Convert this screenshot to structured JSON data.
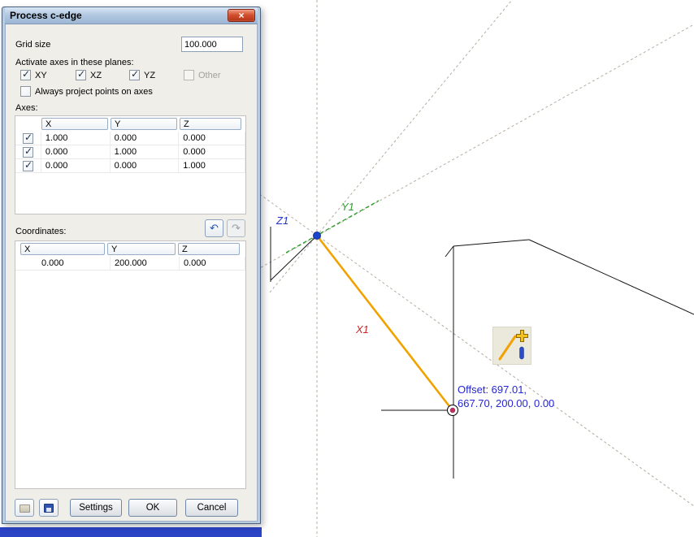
{
  "window": {
    "title": "Process c-edge",
    "icons": {
      "close": "×",
      "undo": "↶",
      "redo": "↷"
    }
  },
  "form": {
    "grid_size_label": "Grid size",
    "grid_size_value": "100.000",
    "planes_label": "Activate axes in these planes:",
    "planes": [
      {
        "label": "XY",
        "check": "✓"
      },
      {
        "label": "XZ",
        "check": "✓"
      },
      {
        "label": "YZ",
        "check": "✓"
      },
      {
        "label": "Other",
        "check": ""
      }
    ],
    "project_points": {
      "label": "Always project points on axes",
      "check": ""
    },
    "axes_label": "Axes:",
    "axes_table": {
      "headers": [
        "X",
        "Y",
        "Z"
      ],
      "rows": [
        {
          "check": "✓",
          "values": [
            "1.000",
            "0.000",
            "0.000"
          ]
        },
        {
          "check": "✓",
          "values": [
            "0.000",
            "1.000",
            "0.000"
          ]
        },
        {
          "check": "✓",
          "values": [
            "0.000",
            "0.000",
            "1.000"
          ]
        }
      ]
    },
    "coordinates_label": "Coordinates:",
    "coordinates_table": {
      "headers": [
        "X",
        "Y",
        "Z"
      ],
      "rows": [
        {
          "values": [
            "0.000",
            "200.000",
            "0.000"
          ]
        }
      ]
    },
    "buttons": {
      "settings": "Settings",
      "ok": "OK",
      "cancel": "Cancel"
    }
  },
  "canvas": {
    "axis_labels": {
      "x": "X1",
      "y": "Y1",
      "z": "Z1"
    },
    "offset_text_line1": "Offset: 697.01,",
    "offset_text_line2": "667.70, 200.00, 0.00",
    "colors": {
      "x_axis_label": "#cc2222",
      "y_axis": "#2ca02c",
      "z_axis_label": "#2233cc",
      "active_axis": "#f2a200",
      "offset_text": "#2525d8",
      "construction_line": "#b6ac9e",
      "origin_point": "#1a44cc",
      "snap_point": "#c03060"
    }
  }
}
